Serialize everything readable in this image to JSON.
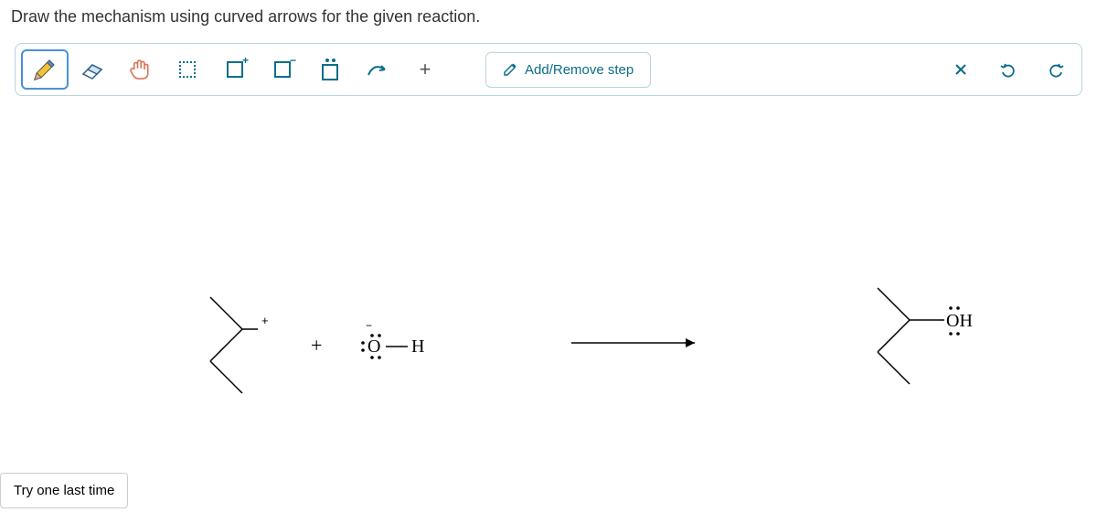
{
  "question": "Draw the mechanism using curved arrows for the given reaction.",
  "toolbar": {
    "pencil": "pencil",
    "eraser": "eraser",
    "hand": "hand",
    "marquee": "marquee select",
    "charge_plus": "+",
    "charge_minus": "−",
    "lone_pair": "lone pair",
    "curved_arrow": "curved arrow",
    "add_atom": "+",
    "add_remove_label": "Add/Remove step",
    "close": "×",
    "undo": "undo",
    "redo": "redo"
  },
  "reaction": {
    "reactant1": {
      "charge": "+",
      "type": "carbocation"
    },
    "plus": "+",
    "reactant2": {
      "charge": "−",
      "atom_o": "O",
      "atom_h": "H",
      "label": ":Ö—H"
    },
    "arrow": "→",
    "product": {
      "group": "OH",
      "label": "ÖH"
    }
  },
  "try_button": "Try one last time"
}
